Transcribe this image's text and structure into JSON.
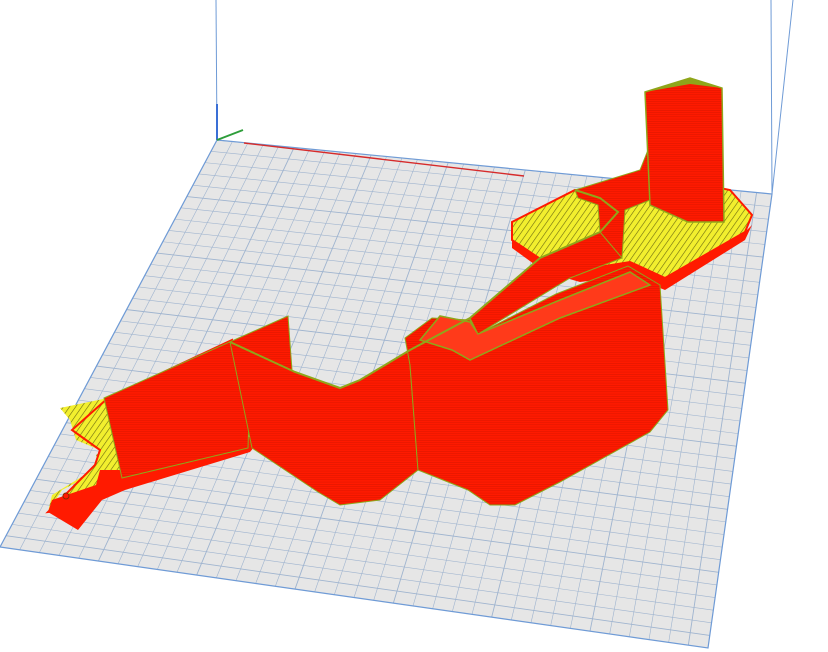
{
  "app": {
    "view": "3d-layer-preview"
  },
  "scene": {
    "background_color": "#ffffff",
    "build_plate": {
      "fill_color": "#e6e6e6",
      "grid_color": "#9fb4cf",
      "edge_color": "#6f9bd6"
    },
    "axes": {
      "x_color": "#d62b2b",
      "y_color": "#2e9e3a",
      "z_color": "#3a6fd6"
    },
    "model": {
      "wall_color": "#ff1a00",
      "infill_color": "#f2ef2e",
      "edge_highlight_color": "#8fa61a"
    }
  }
}
